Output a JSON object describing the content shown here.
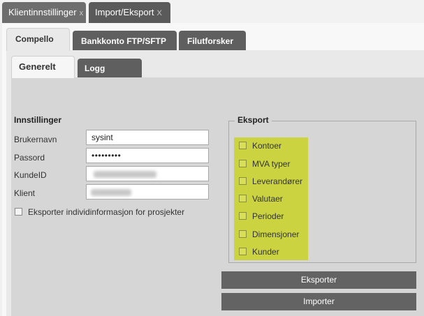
{
  "top_tabs": [
    {
      "label": "Klientinnstillinger",
      "close": "x"
    },
    {
      "label": "Import/Eksport",
      "close": "X"
    }
  ],
  "sub_tabs": [
    "Compello",
    "Bankkonto FTP/SFTP",
    "Filutforsker"
  ],
  "inner_tabs": [
    "Generelt",
    "Logg"
  ],
  "settings": {
    "title": "Innstillinger",
    "username_label": "Brukernavn",
    "username_value": "sysint",
    "password_label": "Passord",
    "password_value": "•••••••••",
    "customer_id_label": "KundeID",
    "client_label": "Klient",
    "checkbox_label": "Eksporter individinformasjon for prosjekter"
  },
  "export": {
    "title": "Eksport",
    "options": [
      "Kontoer",
      "MVA typer",
      "Leverandører",
      "Valutaer",
      "Perioder",
      "Dimensjoner",
      "Kunder"
    ]
  },
  "buttons": {
    "export": "Eksporter",
    "import": "Importer"
  },
  "colors": {
    "highlight": "#cbd341",
    "button": "#636363"
  }
}
